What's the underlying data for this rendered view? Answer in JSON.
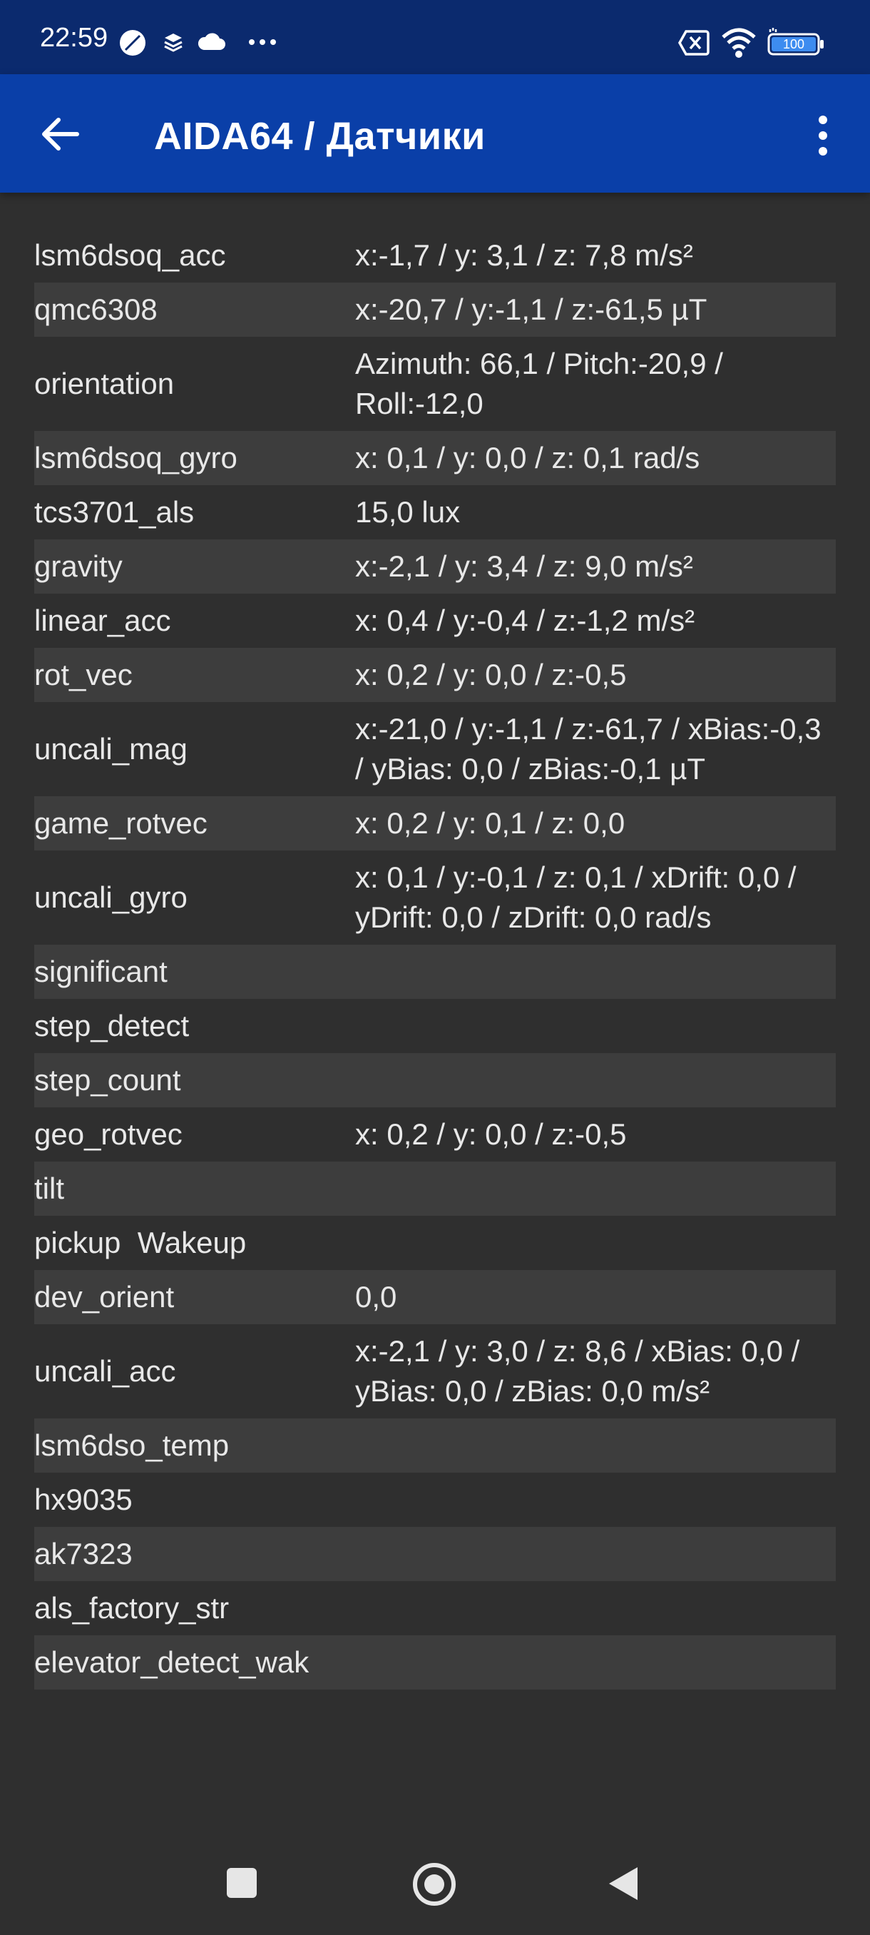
{
  "status_bar": {
    "time": "22:59",
    "icons": [
      "moon-icon",
      "layers-icon",
      "cloud-icon",
      "more-dots-icon",
      "sim-off-icon",
      "wifi-icon",
      "battery-icon"
    ],
    "battery_level": "100"
  },
  "app_bar": {
    "title": "AIDA64  /  Датчики",
    "back_icon": "arrow-back-icon",
    "menu_icon": "more-vert-icon",
    "color": "#0a3fa8"
  },
  "sensors": [
    {
      "name": "lsm6dsoq_acc",
      "value": "x:-1,7 / y: 3,1 / z: 7,8 m/s²"
    },
    {
      "name": "qmc6308",
      "value": "x:-20,7 / y:-1,1 / z:-61,5 µT"
    },
    {
      "name": "orientation",
      "value": "Azimuth: 66,1 / Pitch:-20,9 / Roll:-12,0"
    },
    {
      "name": "lsm6dsoq_gyro",
      "value": "x: 0,1 / y: 0,0 / z: 0,1 rad/s"
    },
    {
      "name": "tcs3701_als",
      "value": "15,0 lux"
    },
    {
      "name": "gravity",
      "value": "x:-2,1 / y: 3,4 / z: 9,0 m/s²"
    },
    {
      "name": "linear_acc",
      "value": "x: 0,4 / y:-0,4 / z:-1,2 m/s²"
    },
    {
      "name": "rot_vec",
      "value": "x: 0,2 / y: 0,0 / z:-0,5"
    },
    {
      "name": "uncali_mag",
      "value": "x:-21,0 / y:-1,1 / z:-61,7 / xBias:-0,3 / yBias: 0,0 / zBias:-0,1 µT"
    },
    {
      "name": "game_rotvec",
      "value": "x: 0,2 / y: 0,1 / z: 0,0"
    },
    {
      "name": "uncali_gyro",
      "value": "x: 0,1 / y:-0,1 / z: 0,1 / xDrift: 0,0 / yDrift: 0,0 / zDrift: 0,0 rad/s"
    },
    {
      "name": "significant",
      "value": ""
    },
    {
      "name": "step_detect",
      "value": ""
    },
    {
      "name": "step_count",
      "value": ""
    },
    {
      "name": "geo_rotvec",
      "value": "x: 0,2 / y: 0,0 / z:-0,5"
    },
    {
      "name": "tilt",
      "value": ""
    },
    {
      "name": "pickup  Wakeup",
      "value": ""
    },
    {
      "name": "dev_orient",
      "value": "0,0"
    },
    {
      "name": "uncali_acc",
      "value": "x:-2,1 / y: 3,0 / z: 8,6 / xBias: 0,0 / yBias: 0,0 / zBias: 0,0 m/s²"
    },
    {
      "name": "lsm6dso_temp",
      "value": ""
    },
    {
      "name": "hx9035",
      "value": ""
    },
    {
      "name": "ak7323",
      "value": ""
    },
    {
      "name": "als_factory_str",
      "value": ""
    },
    {
      "name": "elevator_detect_wak",
      "value": ""
    }
  ],
  "nav_bar": {
    "buttons": [
      "recents-square-icon",
      "home-circle-icon",
      "back-triangle-icon"
    ]
  }
}
